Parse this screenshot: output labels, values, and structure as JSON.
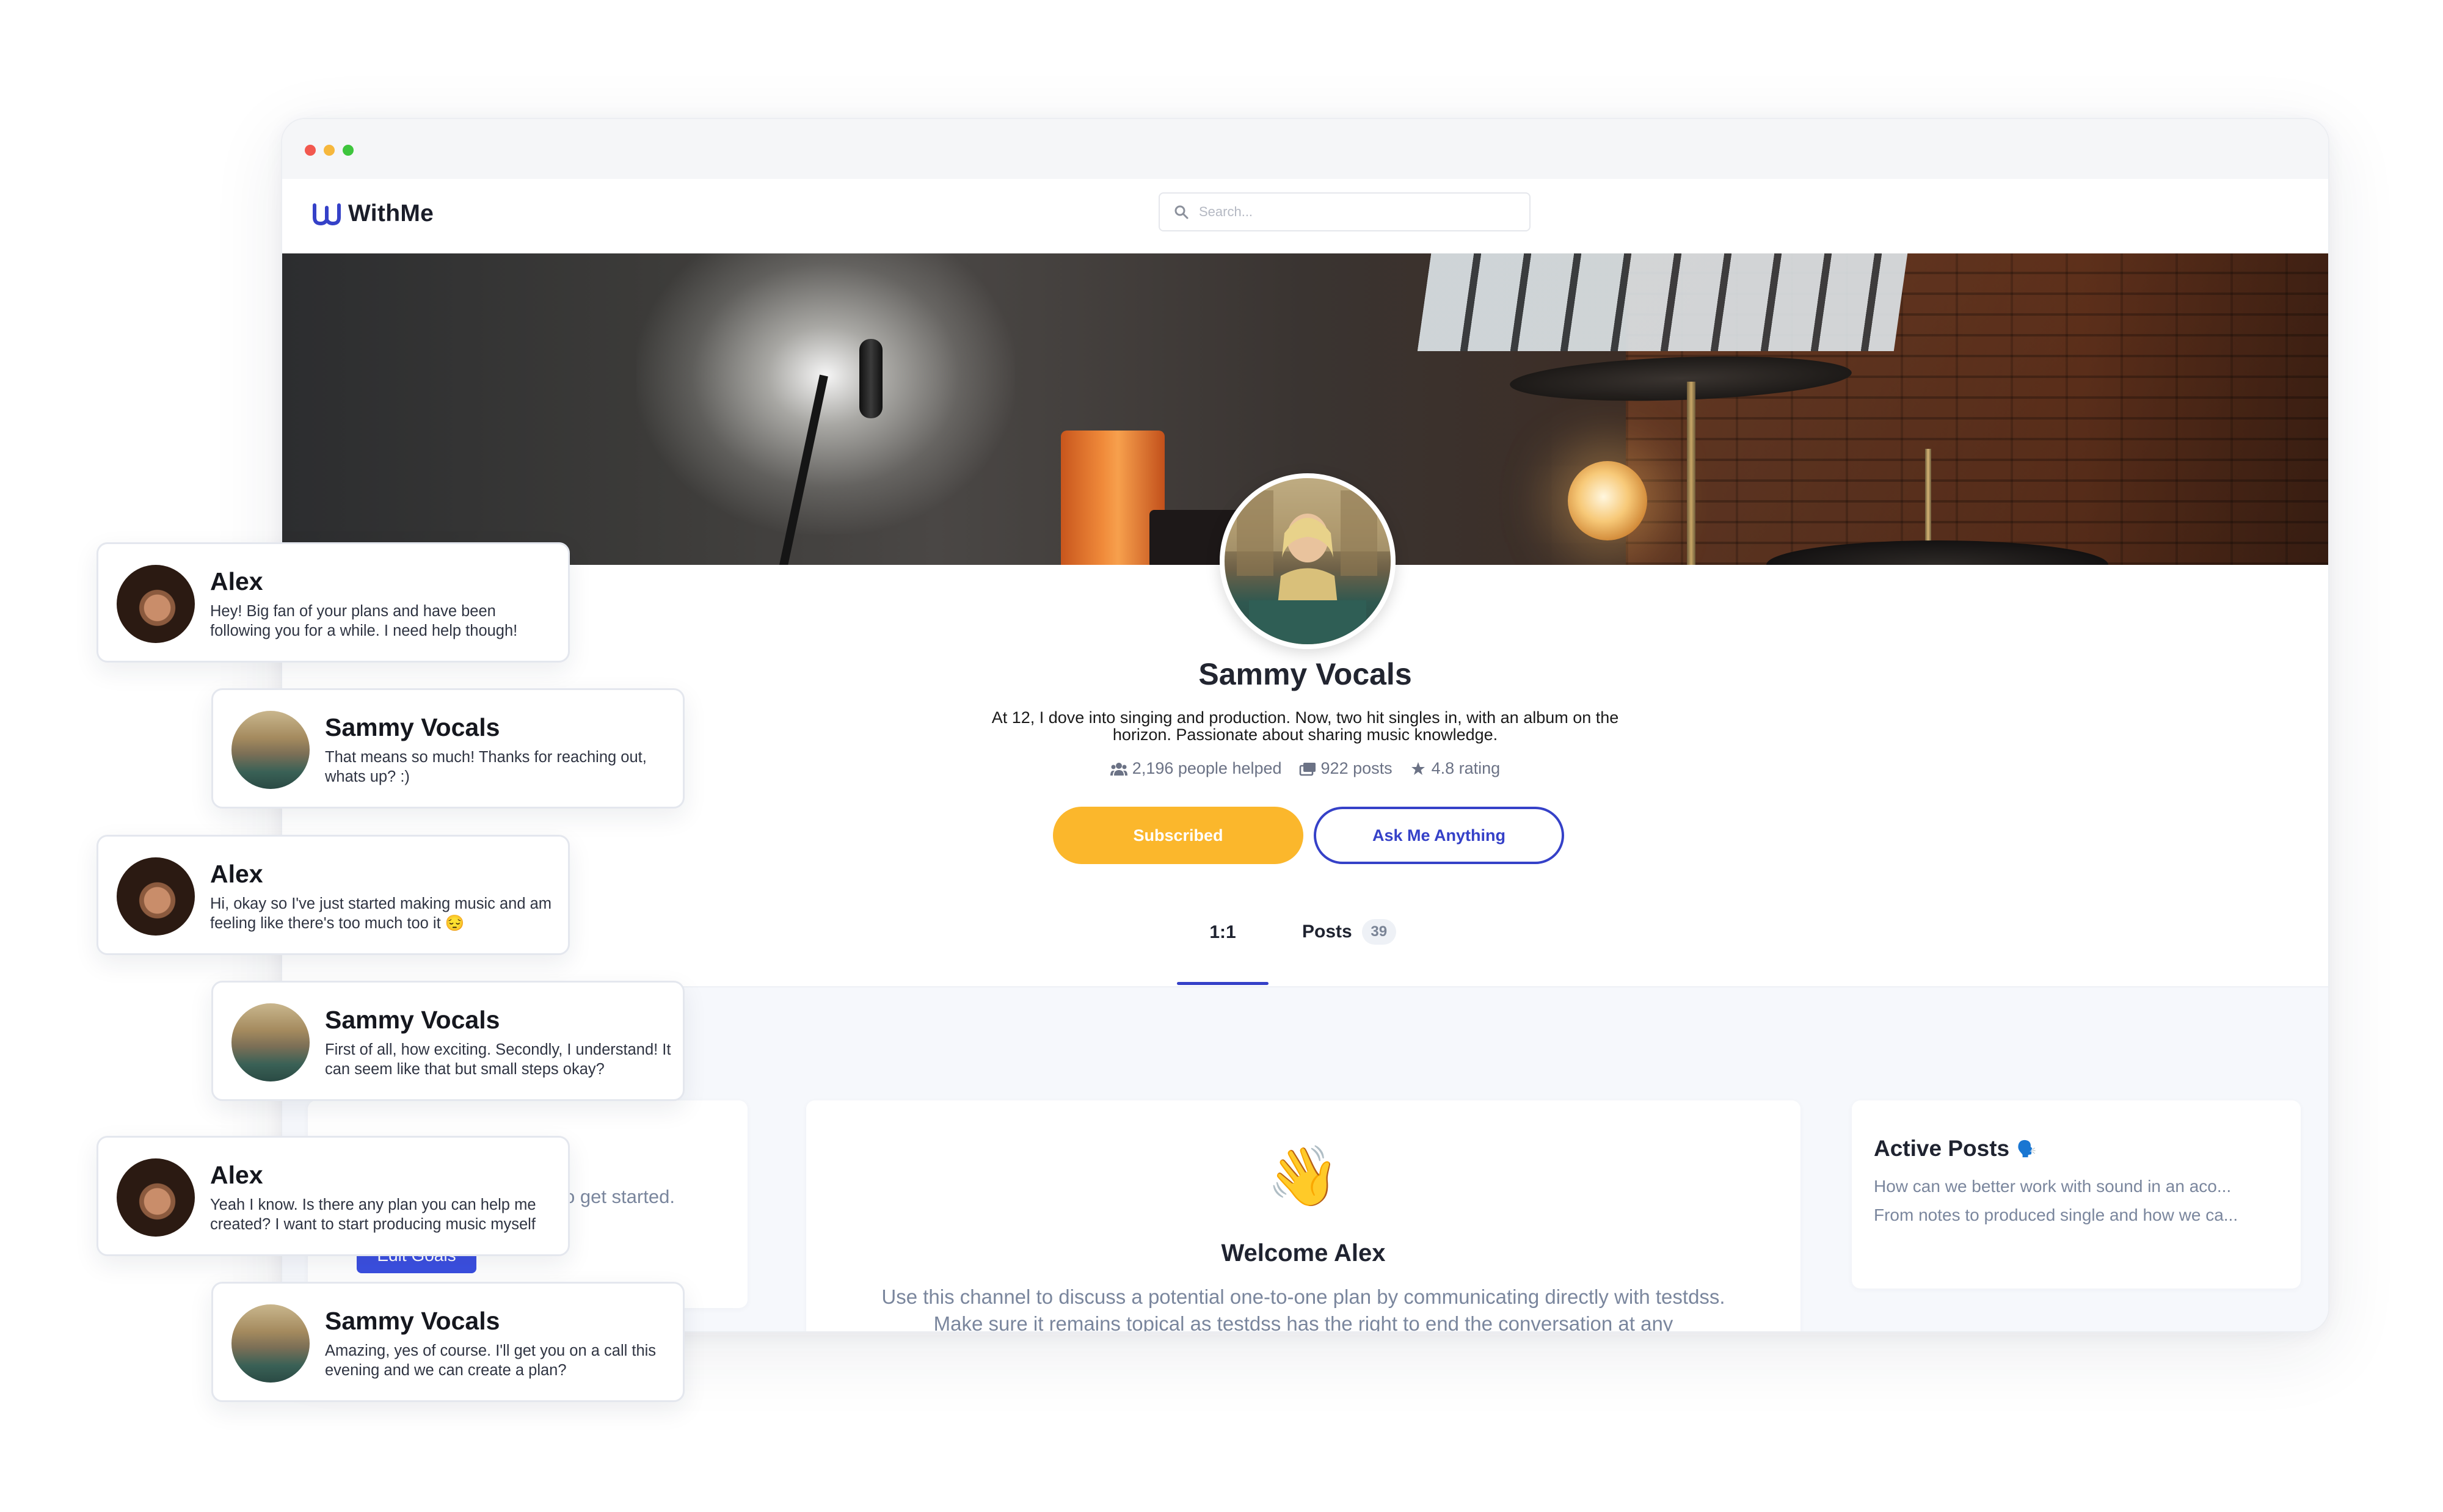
{
  "app": {
    "brand": "WithMe",
    "search_placeholder": "Search..."
  },
  "profile": {
    "name": "Sammy Vocals",
    "bio": "At 12, I dove into singing and production. Now, two hit singles in, with an album on the horizon. Passionate about sharing music knowledge.",
    "stats": {
      "helped": "2,196 people helped",
      "posts": "922 posts",
      "rating": "4.8 rating"
    },
    "subscribed_label": "Subscribed",
    "ask_label": "Ask Me Anything"
  },
  "tabs": {
    "one_on_one": "1:1",
    "posts": "Posts",
    "posts_count": "39"
  },
  "goals_card": {
    "hint": "o get started.",
    "edit_label": "Edit Goals"
  },
  "welcome_card": {
    "emoji": "👋",
    "title": "Welcome Alex",
    "text": "Use this channel to discuss a potential one-to-one plan by communicating directly with testdss. Make sure it remains topical as testdss has the right to end the conversation at any"
  },
  "active_posts": {
    "title": "Active Posts",
    "emoji": "🗣️",
    "items": [
      "How can we better work with sound in an aco...",
      "From notes to produced single and how we ca..."
    ]
  },
  "chat": [
    {
      "sender": "Alex",
      "text": "Hey! Big fan of your plans and have been following you for a while. I need help though!"
    },
    {
      "sender": "Sammy Vocals",
      "text": "That means so much! Thanks for reaching out, whats up? :)"
    },
    {
      "sender": "Alex",
      "text": "Hi, okay so I've just started making music and am feeling like there's too much too it 😔"
    },
    {
      "sender": "Sammy Vocals",
      "text": "First of all, how exciting. Secondly, I understand! It can seem like that but small steps okay?"
    },
    {
      "sender": "Alex",
      "text": "Yeah I know. Is there any plan you can help me created? I want to start producing music myself"
    },
    {
      "sender": "Sammy Vocals",
      "text": "Amazing, yes of course. I'll get you on a call this evening and we can create a plan?"
    }
  ],
  "colors": {
    "accent_blue": "#3541c8",
    "subscribed_yellow": "#fbb72c",
    "muted_text": "#7a869d"
  }
}
